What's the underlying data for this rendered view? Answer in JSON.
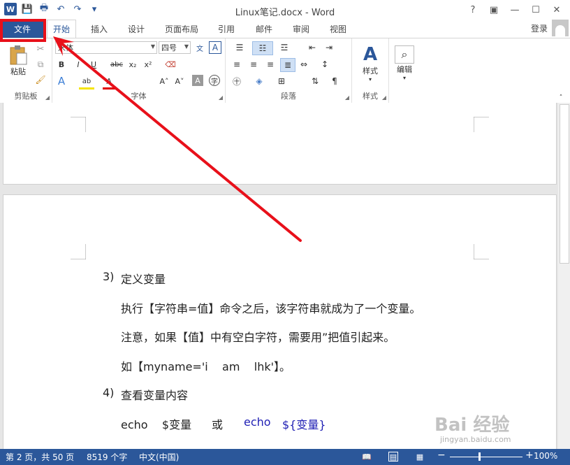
{
  "window": {
    "title": "Linux笔记.docx - Word",
    "controls": [
      "help-icon",
      "ribbon-display-icon",
      "minimize-icon",
      "maximize-icon",
      "close-icon"
    ],
    "help_label": "?",
    "minimize_label": "—",
    "maximize_label": "☐",
    "close_label": "✕"
  },
  "qat": {
    "word_logo": "W",
    "save": "💾",
    "print": "🖶",
    "undo": "↶",
    "redo": "↷",
    "customize": "▾"
  },
  "tabs": {
    "file": "文件",
    "items": [
      "开始",
      "插入",
      "设计",
      "页面布局",
      "引用",
      "邮件",
      "审阅",
      "视图"
    ],
    "active": "开始",
    "login": "登录"
  },
  "ribbon": {
    "clipboard": {
      "label": "剪贴板",
      "paste": "粘贴"
    },
    "font": {
      "label": "字体",
      "font_name": "宋体",
      "font_size": "四号",
      "bold": "B",
      "italic": "I",
      "underline": "U",
      "strike": "abc",
      "subscript": "x₂",
      "superscript": "x²",
      "grow": "A˄",
      "shrink": "A˅",
      "font_color": "A",
      "highlight": "ab"
    },
    "paragraph": {
      "label": "段落"
    },
    "styles": {
      "label": "样式",
      "button": "样式"
    },
    "editing": {
      "button": "编辑"
    }
  },
  "document": {
    "lines": [
      {
        "num": "3)",
        "text": "定义变量"
      },
      {
        "text": "执行【字符串=值】命令之后，该字符串就成为了一个变量。"
      },
      {
        "text": "注意，如果【值】中有空白字符，需要用”把值引起来。"
      },
      {
        "text": "如【myname='i    am    lhk'】。"
      },
      {
        "num": "4)",
        "text": "查看变量内容"
      }
    ],
    "last_line": {
      "part1": "echo    $变量",
      "part2": "或",
      "part3": "echo",
      "part4": "${变量}"
    }
  },
  "statusbar": {
    "page": "第 2 页，共 50 页",
    "words": "8519 个字",
    "language": "中文(中国)",
    "zoom": "100%"
  },
  "watermark": {
    "logo": "Bai 经验",
    "url": "jingyan.baidu.com"
  },
  "colors": {
    "accent": "#2b579a",
    "annotation": "#e8101a",
    "doc_blue": "#1f1fb4"
  }
}
